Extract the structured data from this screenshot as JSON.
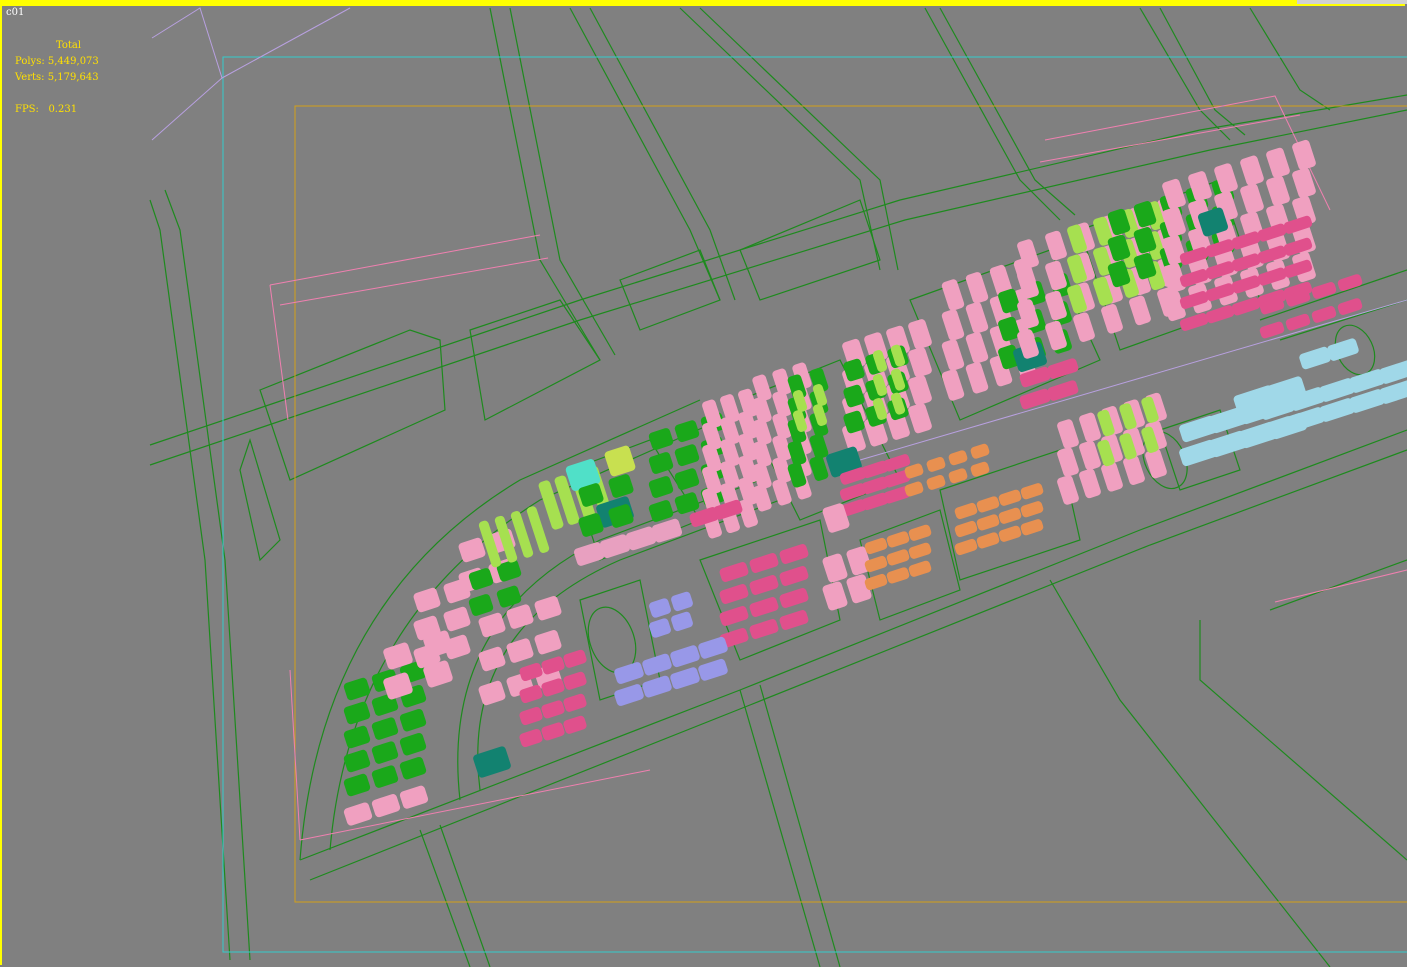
{
  "viewport": {
    "label": "c01",
    "active_border_color": "#ffff00",
    "background_color": "#808080"
  },
  "stats": {
    "header": "Total",
    "polys_label": "Polys:",
    "polys_value": "5,449,073",
    "verts_label": "Verts:",
    "verts_value": "5,179,643",
    "fps_label": "FPS:",
    "fps_value": "0.231",
    "text_color": "#ffe000"
  },
  "scene": {
    "wire_color": "#1e8a1e",
    "safe_frame_outer_color": "#33cccc",
    "safe_frame_inner_color": "#d4a017",
    "building_colors": {
      "residential_pink": "#f0a0c0",
      "residential_magenta": "#e0508c",
      "residential_green": "#1aa81a",
      "residential_lime": "#a6e050",
      "residential_teal": "#128270",
      "commercial_orange": "#e89050",
      "school_lavender": "#9898e8",
      "school_lightblue": "#a0d8e8"
    }
  }
}
